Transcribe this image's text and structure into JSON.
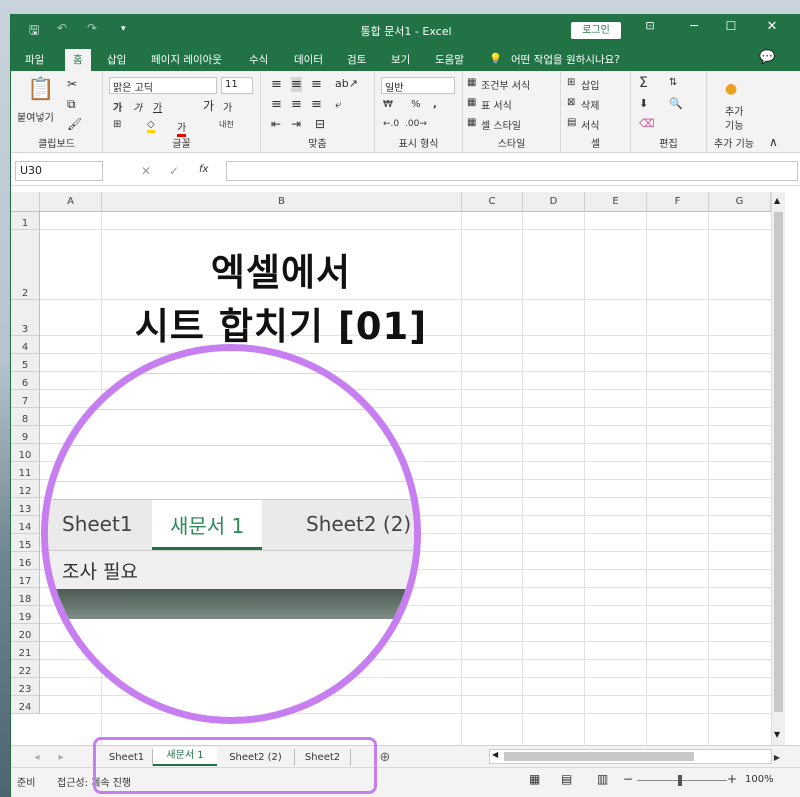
{
  "window": {
    "title": "통합 문서1 - Excel",
    "login_label": "로그인"
  },
  "colors": {
    "accent": "#217346",
    "highlight": "#c77ef0",
    "tab_active_text": "#217346"
  },
  "tabs": [
    "파일",
    "홈",
    "삽입",
    "페이지 레이아웃",
    "수식",
    "데이터",
    "검토",
    "보기",
    "도움말"
  ],
  "active_tab": "홈",
  "tell_me": "어떤 작업을 원하시나요?",
  "ribbon": {
    "clipboard": {
      "paste": "붙여넣기",
      "label": "클립보드"
    },
    "font": {
      "name": "맑은 고딕",
      "size": "11",
      "label": "글꼴",
      "bold": "가",
      "italic": "가",
      "underline": "가",
      "grow": "가",
      "shrink": "가",
      "color_a": "가",
      "phonetic": "내천"
    },
    "alignment": {
      "label": "맞춤"
    },
    "number": {
      "format": "일반",
      "label": "표시 형식"
    },
    "styles": {
      "conditional": "조건부 서식",
      "table": "표 서식",
      "cell": "셀 스타일",
      "label": "스타일"
    },
    "cells": {
      "insert": "삽입",
      "delete": "삭제",
      "format": "서식",
      "label": "셀"
    },
    "editing": {
      "label": "편집"
    },
    "addins": {
      "label_line1": "추가",
      "label_line2": "기능",
      "group": "추가 기능"
    }
  },
  "formula_bar": {
    "name_box": "U30",
    "fx": "fx",
    "value": ""
  },
  "columns": [
    "A",
    "B",
    "C",
    "D",
    "E",
    "F",
    "G"
  ],
  "rows": [
    "1",
    "2",
    "3",
    "4",
    "5",
    "6",
    "7",
    "8",
    "9",
    "10",
    "11",
    "12",
    "13",
    "14",
    "15",
    "16",
    "17",
    "18",
    "19",
    "20",
    "21",
    "22",
    "23",
    "24"
  ],
  "cell_title": {
    "line1": "엑셀에서",
    "line2": "시트 합치기 [01]"
  },
  "zoom_callout": {
    "tabs": [
      "Sheet1",
      "새문서 1",
      "Sheet2 (2)"
    ],
    "status": "조사 필요"
  },
  "sheet_tabs": [
    "Sheet1",
    "새문서 1",
    "Sheet2 (2)",
    "Sheet2"
  ],
  "active_sheet": "새문서 1",
  "status": {
    "ready": "준비",
    "accessibility": "접근성: 계속 진행",
    "zoom": "100%"
  }
}
